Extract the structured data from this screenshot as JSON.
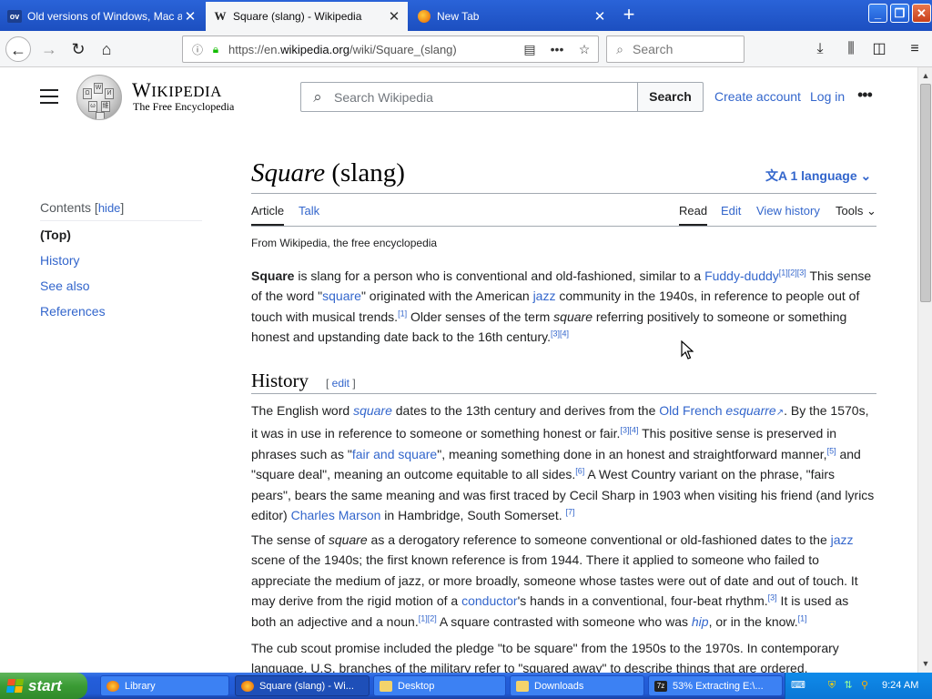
{
  "browser": {
    "tabs": [
      {
        "icon": "ov",
        "title": "Old versions of Windows, Mac and",
        "active": false
      },
      {
        "icon": "W",
        "title": "Square (slang) - Wikipedia",
        "active": true
      },
      {
        "icon": "firefox",
        "title": "New Tab",
        "active": false
      }
    ],
    "url_prefix": "https://en.",
    "url_host": "wikipedia.org",
    "url_path": "/wiki/Square_(slang)",
    "search_placeholder": "Search"
  },
  "wiki": {
    "wordmark": "Wikipedia",
    "tagline": "The Free Encyclopedia",
    "search_placeholder": "Search Wikipedia",
    "search_button": "Search",
    "create_account": "Create account",
    "login": "Log in",
    "toc": {
      "title": "Contents",
      "hide": "hide",
      "items": [
        "(Top)",
        "History",
        "See also",
        "References"
      ]
    },
    "title_italic": "Square",
    "title_rest": " (slang)",
    "language_button": "1 language",
    "tabs": {
      "article": "Article",
      "talk": "Talk",
      "read": "Read",
      "edit": "Edit",
      "view_history": "View history",
      "tools": "Tools"
    },
    "site_sub": "From Wikipedia, the free encyclopedia",
    "intro": {
      "b1": "Square",
      "t1": " is slang for a person who is conventional and old-fashioned, similar to a ",
      "l1": "Fuddy-duddy",
      "r1": "[1][2][3]",
      "t2": " This sense of the word \"",
      "l2": "square",
      "t3": "\" originated with the American ",
      "l3": "jazz",
      "t4": " community in the 1940s, in reference to people out of touch with musical trends.",
      "r2": "[1]",
      "t5": " Older senses of the term ",
      "i1": "square",
      "t6": " referring positively to someone or something honest and upstanding date back to the 16th century.",
      "r3": "[3][4]"
    },
    "history_heading": "History",
    "history_edit": "edit",
    "history_p1": {
      "t1": "The English word ",
      "l1": "square",
      "t2": " dates to the 13th century and derives from the ",
      "l2": "Old French ",
      "l2i": "esquarre",
      "t3": ". By the 1570s, it was in use in reference to someone or something honest or fair.",
      "r1": "[3][4]",
      "t4": " This positive sense is preserved in phrases such as \"",
      "l3": "fair and square",
      "t5": "\", meaning something done in an honest and straightforward manner,",
      "r2": "[5]",
      "t6": " and \"square deal\", meaning an outcome equitable to all sides.",
      "r3": "[6]",
      "t7": " A West Country variant on the phrase, \"fairs pears\", bears the same meaning and was first traced by Cecil Sharp in 1903 when visiting his friend (and lyrics editor) ",
      "l4": "Charles Marson",
      "t8": " in Hambridge, South Somerset. ",
      "r4": "[7]"
    },
    "history_p2": {
      "t1": "The sense of ",
      "i1": "square",
      "t2": " as a derogatory reference to someone conventional or old-fashioned dates to the ",
      "l1": "jazz",
      "t3": " scene of the 1940s; the first known reference is from 1944. There it applied to someone who failed to appreciate the medium of jazz, or more broadly, someone whose tastes were out of date and out of touch. It may derive from the rigid motion of a ",
      "l2": "conductor",
      "t4": "'s hands in a conventional, four-beat rhythm.",
      "r1": "[3]",
      "t5": " It is used as both an adjective and a noun.",
      "r2": "[1][2]",
      "t6": " A square contrasted with someone who was ",
      "l3": "hip",
      "t7": ", or in the know.",
      "r3": "[1]"
    },
    "history_p3": "The cub scout promise included the pledge \"to be square\" from the 1950s to the 1970s. In contemporary language, U.S. branches of the military refer to \"squared away\" to describe things that are ordered."
  },
  "taskbar": {
    "start": "start",
    "items": [
      {
        "label": "Library",
        "active": false
      },
      {
        "label": "Square (slang) - Wi...",
        "active": true
      },
      {
        "label": "Desktop",
        "active": false
      },
      {
        "label": "Downloads",
        "active": false
      },
      {
        "label": "53% Extracting E:\\...",
        "active": false
      }
    ],
    "clock": "9:24 AM"
  },
  "colors": {
    "link": "#3366cc",
    "text": "#202122",
    "xp_blue": "#245edb",
    "xp_green": "#3a9b34"
  }
}
